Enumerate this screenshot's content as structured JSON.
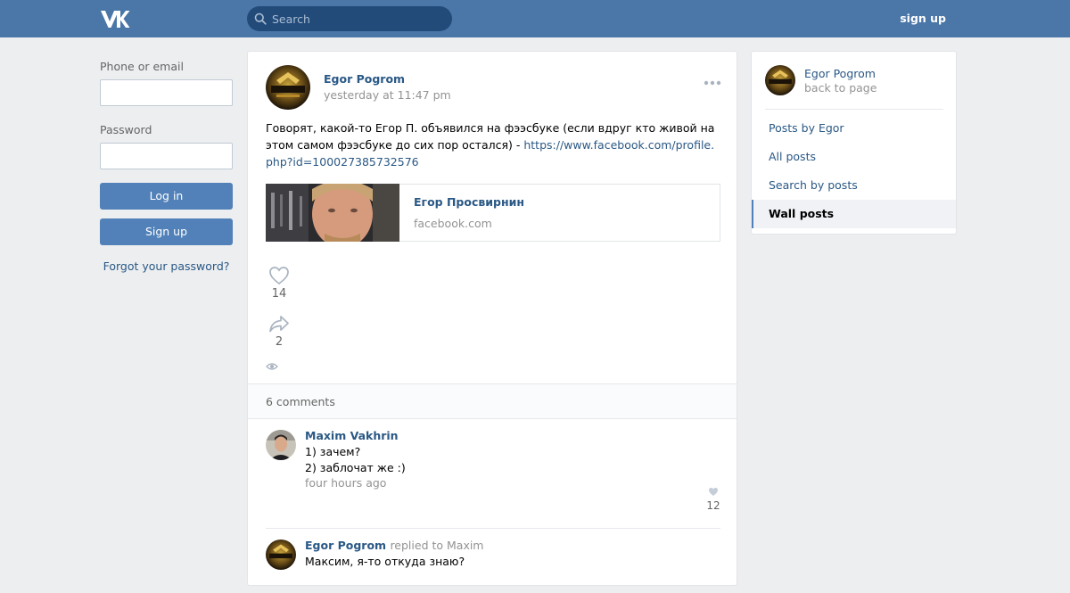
{
  "header": {
    "search_placeholder": "Search",
    "signup_label": "sign up"
  },
  "login": {
    "phone_label": "Phone or email",
    "password_label": "Password",
    "login_button": "Log in",
    "signup_button": "Sign up",
    "forgot_link": "Forgot your password?"
  },
  "post": {
    "author": "Egor Pogrom",
    "time": "yesterday at 11:47 pm",
    "text": "Говорят, какой-то Егор П. объявился на фээсбуке (если вдруг кто живой на этом самом фээсбуке до сих пор остался) - ",
    "link_url": "https://www.facebook.com/profile.php?id=100027385732576",
    "link_card": {
      "title": "Егор Просвирнин",
      "domain": "facebook.com"
    },
    "likes": "14",
    "shares": "2",
    "comments_count": "6 comments"
  },
  "comments": [
    {
      "author": "Maxim Vakhrin",
      "replied_to": "",
      "lines": [
        "1) зачем?",
        "2) заблочат же :)"
      ],
      "time": "four hours ago",
      "likes": "12"
    },
    {
      "author": "Egor Pogrom",
      "replied_to": "replied to Maxim",
      "lines": [
        "Максим, я-то откуда знаю?"
      ],
      "time": "",
      "likes": ""
    }
  ],
  "sidebar": {
    "name": "Egor Pogrom",
    "back": "back to page",
    "items": [
      {
        "label": "Posts by Egor",
        "active": false
      },
      {
        "label": "All posts",
        "active": false
      },
      {
        "label": "Search by posts",
        "active": false
      },
      {
        "label": "Wall posts",
        "active": true
      }
    ]
  },
  "colors": {
    "header_bg": "#4a76a8",
    "search_bg": "#224b7a",
    "button_bg": "#5181b8",
    "link": "#2a5885",
    "page_bg": "#edeef0"
  },
  "icons": {
    "logo": "vk-logo-icon",
    "search": "search-icon",
    "more": "more-dots-icon",
    "like": "heart-icon",
    "share": "share-arrow-icon",
    "views": "eye-icon"
  }
}
